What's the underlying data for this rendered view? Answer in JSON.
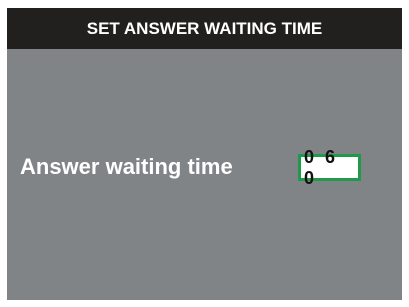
{
  "header": {
    "title": "SET ANSWER WAITING TIME"
  },
  "setting": {
    "label": "Answer waiting time",
    "value": "0 6 0"
  },
  "colors": {
    "title_bar": "#221f1f",
    "panel": "#818487",
    "highlight": "#1e9a4a"
  }
}
